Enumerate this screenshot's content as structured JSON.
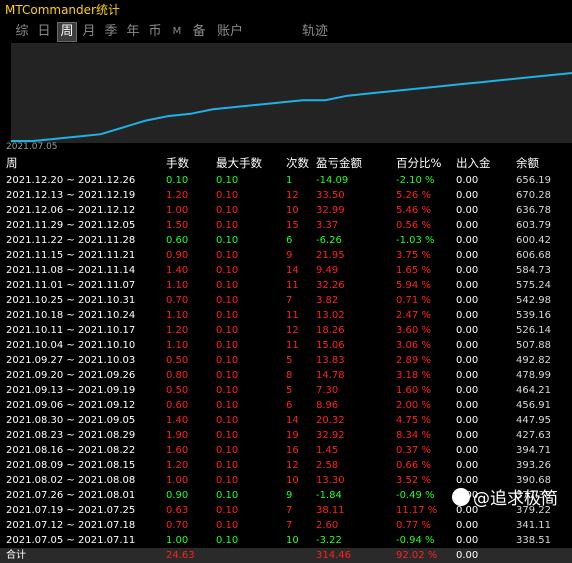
{
  "app": {
    "title": "MTCommander统计"
  },
  "tabs": [
    {
      "label": "综"
    },
    {
      "label": "日"
    },
    {
      "label": "周"
    },
    {
      "label": "月"
    },
    {
      "label": "季"
    },
    {
      "label": "年"
    },
    {
      "label": "币"
    },
    {
      "label": "M"
    },
    {
      "label": "备"
    },
    {
      "label": "账户"
    },
    {
      "label": "轨迹"
    }
  ],
  "active_tab": "周",
  "chart": {
    "start_date": "2021.07.05",
    "line_color": "#1fb1e6",
    "points": [
      0.1,
      0.1,
      0.15,
      0.2,
      0.25,
      0.4,
      0.55,
      0.65,
      0.7,
      0.8,
      0.85,
      0.9,
      0.95,
      1.0,
      1.0,
      1.1,
      1.15,
      1.2,
      1.25,
      1.3,
      1.35,
      1.4,
      1.45,
      1.5,
      1.55,
      1.6
    ]
  },
  "table": {
    "headers": {
      "week": "周",
      "lots": "手数",
      "max_lots": "最大手数",
      "count": "次数",
      "pnl": "盈亏金额",
      "pct": "百分比%",
      "io": "出入金",
      "balance": "余额"
    },
    "rows": [
      {
        "week": "2021.12.20 ~ 2021.12.26",
        "lots": "0.10",
        "max": "0.10",
        "count": "1",
        "pnl": "-14.09",
        "pct": "-2.10 %",
        "io": "0.00",
        "bal": "656.19",
        "sign": "neg"
      },
      {
        "week": "2021.12.13 ~ 2021.12.19",
        "lots": "1.20",
        "max": "0.10",
        "count": "12",
        "pnl": "33.50",
        "pct": "5.26 %",
        "io": "0.00",
        "bal": "670.28",
        "sign": "pos"
      },
      {
        "week": "2021.12.06 ~ 2021.12.12",
        "lots": "1.00",
        "max": "0.10",
        "count": "10",
        "pnl": "32.99",
        "pct": "5.46 %",
        "io": "0.00",
        "bal": "636.78",
        "sign": "pos"
      },
      {
        "week": "2021.11.29 ~ 2021.12.05",
        "lots": "1.50",
        "max": "0.10",
        "count": "15",
        "pnl": "3.37",
        "pct": "0.56 %",
        "io": "0.00",
        "bal": "603.79",
        "sign": "pos"
      },
      {
        "week": "2021.11.22 ~ 2021.11.28",
        "lots": "0.60",
        "max": "0.10",
        "count": "6",
        "pnl": "-6.26",
        "pct": "-1.03 %",
        "io": "0.00",
        "bal": "600.42",
        "sign": "neg"
      },
      {
        "week": "2021.11.15 ~ 2021.11.21",
        "lots": "0.90",
        "max": "0.10",
        "count": "9",
        "pnl": "21.95",
        "pct": "3.75 %",
        "io": "0.00",
        "bal": "606.68",
        "sign": "pos"
      },
      {
        "week": "2021.11.08 ~ 2021.11.14",
        "lots": "1.40",
        "max": "0.10",
        "count": "14",
        "pnl": "9.49",
        "pct": "1.65 %",
        "io": "0.00",
        "bal": "584.73",
        "sign": "pos"
      },
      {
        "week": "2021.11.01 ~ 2021.11.07",
        "lots": "1.10",
        "max": "0.10",
        "count": "11",
        "pnl": "32.26",
        "pct": "5.94 %",
        "io": "0.00",
        "bal": "575.24",
        "sign": "pos"
      },
      {
        "week": "2021.10.25 ~ 2021.10.31",
        "lots": "0.70",
        "max": "0.10",
        "count": "7",
        "pnl": "3.82",
        "pct": "0.71 %",
        "io": "0.00",
        "bal": "542.98",
        "sign": "pos"
      },
      {
        "week": "2021.10.18 ~ 2021.10.24",
        "lots": "1.10",
        "max": "0.10",
        "count": "11",
        "pnl": "13.02",
        "pct": "2.47 %",
        "io": "0.00",
        "bal": "539.16",
        "sign": "pos"
      },
      {
        "week": "2021.10.11 ~ 2021.10.17",
        "lots": "1.20",
        "max": "0.10",
        "count": "12",
        "pnl": "18.26",
        "pct": "3.60 %",
        "io": "0.00",
        "bal": "526.14",
        "sign": "pos"
      },
      {
        "week": "2021.10.04 ~ 2021.10.10",
        "lots": "1.10",
        "max": "0.10",
        "count": "11",
        "pnl": "15.06",
        "pct": "3.06 %",
        "io": "0.00",
        "bal": "507.88",
        "sign": "pos"
      },
      {
        "week": "2021.09.27 ~ 2021.10.03",
        "lots": "0.50",
        "max": "0.10",
        "count": "5",
        "pnl": "13.83",
        "pct": "2.89 %",
        "io": "0.00",
        "bal": "492.82",
        "sign": "pos"
      },
      {
        "week": "2021.09.20 ~ 2021.09.26",
        "lots": "0.80",
        "max": "0.10",
        "count": "8",
        "pnl": "14.78",
        "pct": "3.18 %",
        "io": "0.00",
        "bal": "478.99",
        "sign": "pos"
      },
      {
        "week": "2021.09.13 ~ 2021.09.19",
        "lots": "0.50",
        "max": "0.10",
        "count": "5",
        "pnl": "7.30",
        "pct": "1.60 %",
        "io": "0.00",
        "bal": "464.21",
        "sign": "pos"
      },
      {
        "week": "2021.09.06 ~ 2021.09.12",
        "lots": "0.60",
        "max": "0.10",
        "count": "6",
        "pnl": "8.96",
        "pct": "2.00 %",
        "io": "0.00",
        "bal": "456.91",
        "sign": "pos"
      },
      {
        "week": "2021.08.30 ~ 2021.09.05",
        "lots": "1.40",
        "max": "0.10",
        "count": "14",
        "pnl": "20.32",
        "pct": "4.75 %",
        "io": "0.00",
        "bal": "447.95",
        "sign": "pos"
      },
      {
        "week": "2021.08.23 ~ 2021.08.29",
        "lots": "1.90",
        "max": "0.10",
        "count": "19",
        "pnl": "32.92",
        "pct": "8.34 %",
        "io": "0.00",
        "bal": "427.63",
        "sign": "pos"
      },
      {
        "week": "2021.08.16 ~ 2021.08.22",
        "lots": "1.60",
        "max": "0.10",
        "count": "16",
        "pnl": "1.45",
        "pct": "0.37 %",
        "io": "0.00",
        "bal": "394.71",
        "sign": "pos"
      },
      {
        "week": "2021.08.09 ~ 2021.08.15",
        "lots": "1.20",
        "max": "0.10",
        "count": "12",
        "pnl": "2.58",
        "pct": "0.66 %",
        "io": "0.00",
        "bal": "393.26",
        "sign": "pos"
      },
      {
        "week": "2021.08.02 ~ 2021.08.08",
        "lots": "1.00",
        "max": "0.10",
        "count": "10",
        "pnl": "13.30",
        "pct": "3.52 %",
        "io": "0.00",
        "bal": "390.68",
        "sign": "pos"
      },
      {
        "week": "2021.07.26 ~ 2021.08.01",
        "lots": "0.90",
        "max": "0.10",
        "count": "9",
        "pnl": "-1.84",
        "pct": "-0.49 %",
        "io": "0.00",
        "bal": "377.38",
        "sign": "neg"
      },
      {
        "week": "2021.07.19 ~ 2021.07.25",
        "lots": "0.63",
        "max": "0.10",
        "count": "7",
        "pnl": "38.11",
        "pct": "11.17 %",
        "io": "0.00",
        "bal": "379.22",
        "sign": "pos"
      },
      {
        "week": "2021.07.12 ~ 2021.07.18",
        "lots": "0.70",
        "max": "0.10",
        "count": "7",
        "pnl": "2.60",
        "pct": "0.77 %",
        "io": "0.00",
        "bal": "341.11",
        "sign": "pos"
      },
      {
        "week": "2021.07.05 ~ 2021.07.11",
        "lots": "1.00",
        "max": "0.10",
        "count": "10",
        "pnl": "-3.22",
        "pct": "-0.94 %",
        "io": "0.00",
        "bal": "338.51",
        "sign": "neg"
      }
    ],
    "total": {
      "label": "合计",
      "lots": "24.63",
      "pnl": "314.46",
      "pct": "92.02 %",
      "io": "0.00"
    }
  },
  "watermark": {
    "text": "@追求极简"
  },
  "colors": {
    "positive": "#ff2020",
    "negative": "#20ff20",
    "title": "#ffd200"
  }
}
